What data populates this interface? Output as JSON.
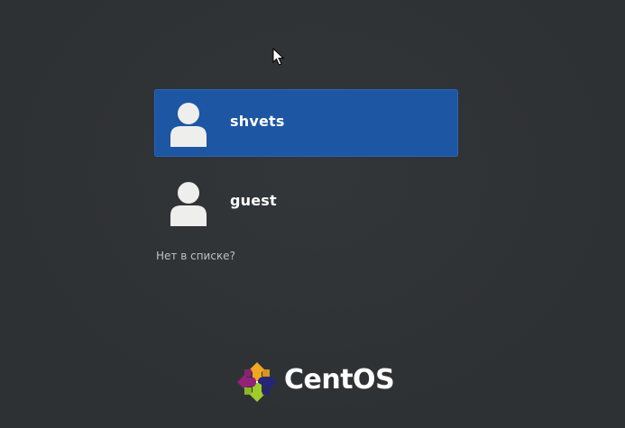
{
  "users": [
    {
      "name": "shvets",
      "selected": true
    },
    {
      "name": "guest",
      "selected": false
    }
  ],
  "not_listed_label": "Нет в списке?",
  "logo_text": "CentOS",
  "colors": {
    "background": "#2e3133",
    "selection": "#1d56a3",
    "text": "#ffffff",
    "muted_text": "#bfc2c2"
  },
  "icons": {
    "avatar": "avatar-default-icon",
    "cursor": "mouse-pointer-icon",
    "logo": "centos-logo-icon"
  }
}
